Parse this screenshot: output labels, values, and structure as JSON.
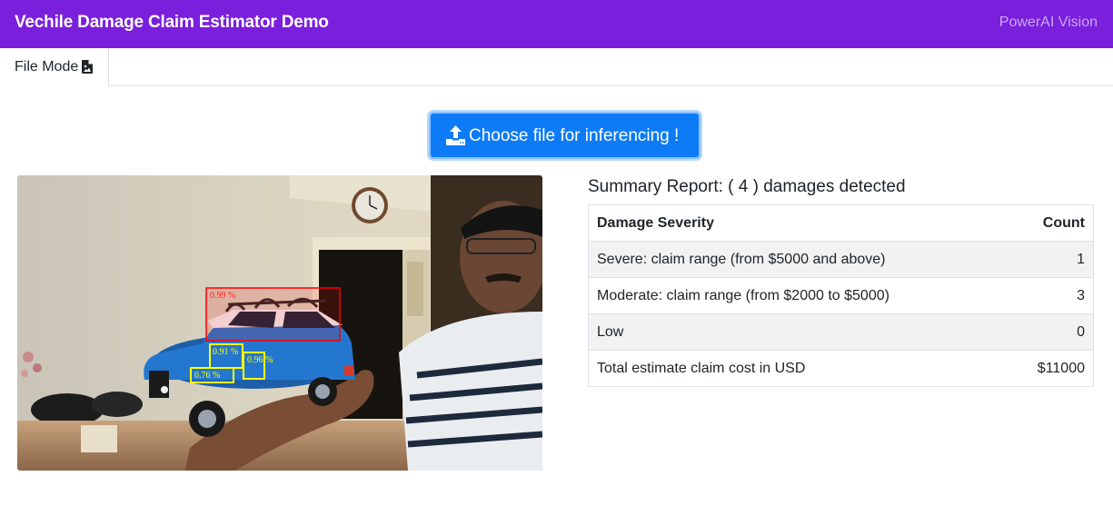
{
  "navbar": {
    "brand": "Vechile Damage Claim Estimator Demo",
    "right_link": "PowerAI Vision",
    "bg_color": "#7a1fdc"
  },
  "tabs": [
    {
      "label": "File Mode",
      "icon": "file-image-icon",
      "active": true
    }
  ],
  "upload": {
    "label": "Choose file for inferencing !",
    "icon": "upload-icon",
    "color": "#0d7bf5"
  },
  "image": {
    "detections": [
      {
        "label": "0.99 %",
        "color": "#ff0000"
      },
      {
        "label": "0.91 %",
        "color": "#ffff00"
      },
      {
        "label": "0.96 %",
        "color": "#ffff00"
      },
      {
        "label": "0.76 %",
        "color": "#ffff00"
      }
    ]
  },
  "summary": {
    "title": "Summary Report: ( 4 ) damages detected",
    "headers": [
      "Damage Severity",
      "Count"
    ],
    "rows": [
      {
        "label": "Severe: claim range (from $5000 and above)",
        "value": "1"
      },
      {
        "label": "Moderate: claim range (from $2000 to $5000)",
        "value": "3"
      },
      {
        "label": "Low",
        "value": "0"
      },
      {
        "label": "Total estimate claim cost in USD",
        "value": "$11000"
      }
    ]
  }
}
